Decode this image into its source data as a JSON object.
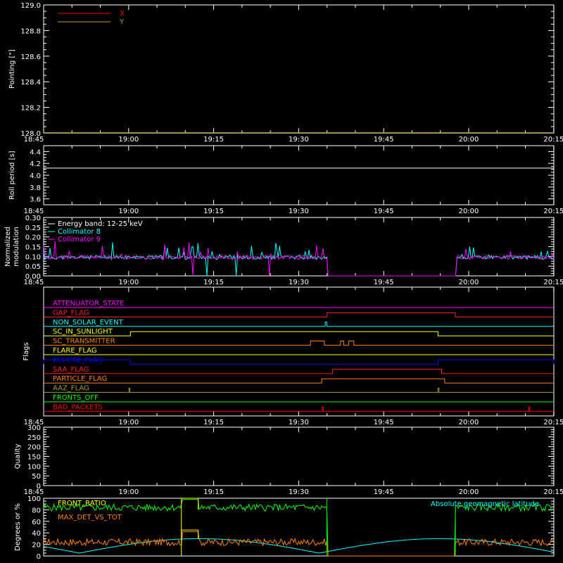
{
  "chart_data": [
    {
      "type": "line",
      "ylabel": "Pointing [\"]",
      "yticks": [
        "128.0",
        "128.2",
        "128.4",
        "128.6",
        "128.8",
        "129.0"
      ],
      "ylim": [
        128.0,
        129.0
      ],
      "xticks": [
        "18:45",
        "19:00",
        "19:15",
        "19:30",
        "19:45",
        "20:00",
        "20:15"
      ],
      "xlim_min": [
        0,
        100
      ],
      "legend": [
        {
          "name": "X",
          "color": "#ff0000"
        },
        {
          "name": "Y",
          "color": "#c0a020"
        }
      ],
      "series": [
        {
          "name": "X",
          "color": "#ff0000",
          "x": [
            0,
            100
          ],
          "values": [
            128.0,
            128.0
          ]
        },
        {
          "name": "Y",
          "color": "#c0a020",
          "x": [
            0,
            100
          ],
          "values": [
            128.0,
            128.0
          ]
        }
      ]
    },
    {
      "type": "line",
      "ylabel": "Roll period [s]",
      "yticks": [
        "3.6",
        "3.8",
        "4.0",
        "4.2",
        "4.4"
      ],
      "ylim": [
        3.5,
        4.5
      ],
      "xticks": [
        "18:45",
        "19:00",
        "19:15",
        "19:30",
        "19:45",
        "20:00",
        "20:15"
      ],
      "series": [
        {
          "name": "roll",
          "color": "#ffffff",
          "x": [
            0,
            100
          ],
          "values": [
            4.12,
            4.12
          ]
        }
      ]
    },
    {
      "type": "line",
      "ylabel": "Normalized",
      "ylabel2": "modulation",
      "yticks": [
        "0.00",
        "0.05",
        "0.10",
        "0.15",
        "0.20",
        "0.25",
        "0.30"
      ],
      "ylim": [
        0,
        0.3
      ],
      "xticks": [
        "18:45",
        "19:00",
        "19:15",
        "19:30",
        "19:45",
        "20:00",
        "20:15"
      ],
      "legend": [
        {
          "name": "Energy band: 12-25 keV",
          "color": "#ffffff"
        },
        {
          "name": "Collimator 8",
          "color": "#00ffff"
        },
        {
          "name": "Collimator 9",
          "color": "#ff00ff"
        }
      ],
      "gap_range": [
        55.5,
        100
      ]
    },
    {
      "type": "line",
      "ylabel": "Flags",
      "xticks": [
        "18:45",
        "19:00",
        "19:15",
        "19:30",
        "19:45",
        "20:00",
        "20:15"
      ],
      "flags": [
        {
          "label": "ATTENUATOR_STATE",
          "color": "#ff00ff",
          "steps": []
        },
        {
          "label": "GAP_FLAG",
          "color": "#ff2020",
          "steps": [
            [
              55.5,
              80.7
            ]
          ]
        },
        {
          "label": "NON_SOLAR_EVENT",
          "color": "#00ffff",
          "steps": [
            [
              55.2,
              55.5
            ]
          ]
        },
        {
          "label": "SC_IN_SUNLIGHT",
          "color": "#ffff00",
          "steps": [
            [
              17.0,
              77.3
            ]
          ]
        },
        {
          "label": "SC_TRANSMITTER",
          "color": "#ff8000",
          "steps": [
            [
              52.3,
              55.0
            ],
            [
              58.2,
              58.8
            ],
            [
              59.8,
              60.8
            ]
          ]
        },
        {
          "label": "FLARE_FLAG",
          "color": "#ffff00",
          "steps": []
        },
        {
          "label": "ECLIPSE_FLAG",
          "color": "#0000ff",
          "steps": [
            [
              0,
              17.0
            ],
            [
              77.3,
              100
            ]
          ]
        },
        {
          "label": "SAA_FLAG",
          "color": "#ff2020",
          "steps": [
            [
              56.6,
              78.0
            ]
          ]
        },
        {
          "label": "PARTICLE_FLAG",
          "color": "#ff8000",
          "steps": [
            [
              54.5,
              78.6
            ]
          ]
        },
        {
          "label": "AAZ_FLAG",
          "color": "#a0a020",
          "steps": [
            [
              16.7,
              16.9
            ],
            [
              77.3,
              77.5
            ]
          ]
        },
        {
          "label": "FRONTS_OFF",
          "color": "#00ff00",
          "steps": []
        },
        {
          "label": "BAD_PACKETS",
          "color": "#ff0000",
          "steps": [
            [
              54.6,
              54.8
            ],
            [
              95.1,
              95.3
            ]
          ]
        }
      ]
    },
    {
      "type": "line",
      "ylabel": "Quality",
      "yticks": [
        "0",
        "50",
        "100",
        "150",
        "200",
        "250",
        "300"
      ],
      "ylim": [
        0,
        300
      ],
      "xticks": [
        "18:45",
        "19:00",
        "19:15",
        "19:30",
        "19:45",
        "20:00",
        "20:15"
      ],
      "series": [
        {
          "name": "quality",
          "color": "#ffffff",
          "x": [
            0,
            100
          ],
          "values": [
            0,
            0
          ]
        }
      ]
    },
    {
      "type": "line",
      "ylabel": "Degrees or %",
      "yticks": [
        "0",
        "20",
        "40",
        "60",
        "80",
        "100"
      ],
      "ylim": [
        0,
        100
      ],
      "legend": [
        {
          "name": "FRONT_RATIO",
          "color": "#ffff00"
        },
        {
          "name": "MAX_DET_VS_TOT",
          "color": "#ff8000"
        },
        {
          "name": "Absolute geomagnetic latitude",
          "color": "#00ffff"
        }
      ]
    }
  ]
}
